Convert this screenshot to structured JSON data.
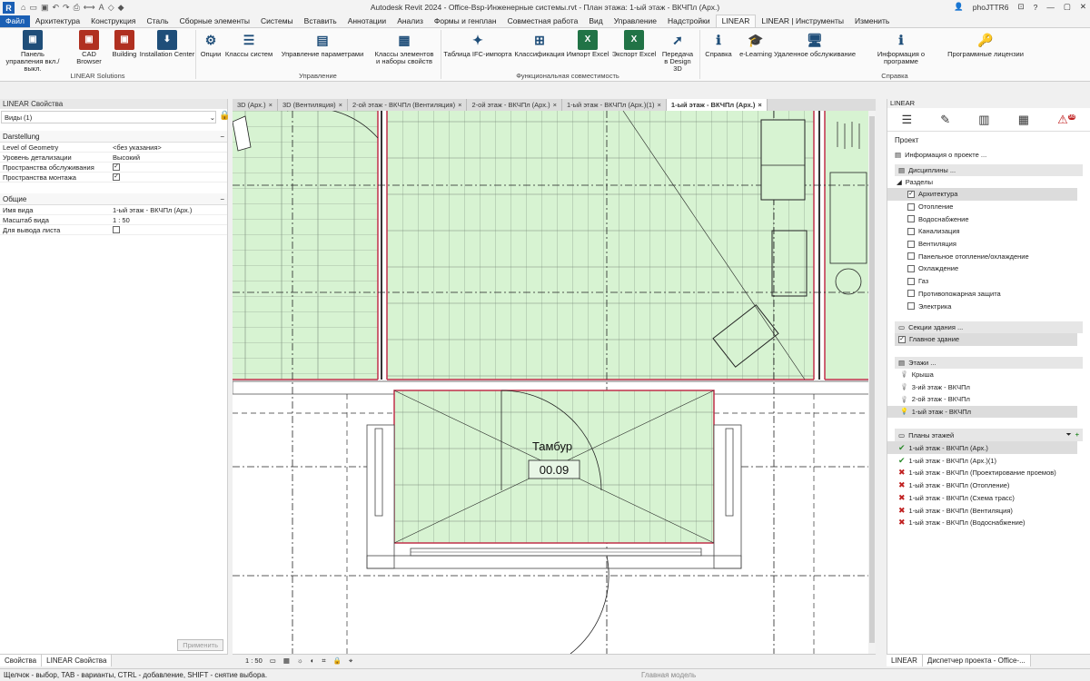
{
  "app": {
    "title": "Autodesk Revit 2024 - Office-Bsp-Инженерные системы.rvt - План этажа: 1-ый этаж - ВКЧПл (Арх.)",
    "user": "phoJTTR6"
  },
  "menu": [
    "Файл",
    "Архитектура",
    "Конструкция",
    "Сталь",
    "Сборные элементы",
    "Системы",
    "Вставить",
    "Аннотации",
    "Анализ",
    "Формы и генплан",
    "Совместная работа",
    "Вид",
    "Управление",
    "Надстройки",
    "LINEAR",
    "LINEAR | Инструменты",
    "Изменить"
  ],
  "ribbon": {
    "buttons": [
      {
        "label": "Панель управления вкл./выкл.",
        "color": "#1f4e79"
      },
      {
        "label": "CAD Browser",
        "color": "#b03020"
      },
      {
        "label": "Building",
        "color": "#b03020"
      },
      {
        "label": "Installation Center",
        "color": "#1f4e79"
      },
      {
        "label": "Опции"
      },
      {
        "label": "Классы систем"
      },
      {
        "label": "Управление параметрами"
      },
      {
        "label": "Классы элементов и наборы свойств"
      },
      {
        "label": "Таблица IFC-импорта"
      },
      {
        "label": "Классификация"
      },
      {
        "label": "Импорт Excel",
        "color": "#217346"
      },
      {
        "label": "Экспорт Excel",
        "color": "#217346"
      },
      {
        "label": "Передача в Design 3D"
      },
      {
        "label": "Справка"
      },
      {
        "label": "e-Learning"
      },
      {
        "label": "Удаленное обслуживание"
      },
      {
        "label": "Информация о программе"
      },
      {
        "label": "Программные лицензии"
      }
    ],
    "groups": [
      "LINEAR Solutions",
      "Управление",
      "Функциональная совместимость",
      "Справка"
    ]
  },
  "props": {
    "title": "LINEAR Свойства",
    "type": "Виды (1)",
    "darstellung": "Darstellung",
    "rows1": [
      {
        "k": "Level of Geometry",
        "v": "<без указания>"
      },
      {
        "k": "Уровень детализации",
        "v": "Высокий"
      },
      {
        "k": "Пространства обслуживания",
        "v": "✓"
      },
      {
        "k": "Пространства монтажа",
        "v": "✓"
      }
    ],
    "general": "Общие",
    "rows2": [
      {
        "k": "Имя вида",
        "v": "1-ый этаж - ВКЧПл (Арх.)"
      },
      {
        "k": "Масштаб вида",
        "v": "1 : 50"
      },
      {
        "k": "Для вывода листа",
        "v": ""
      }
    ],
    "apply": "Применить",
    "tabs": [
      "Свойства",
      "LINEAR Свойства"
    ]
  },
  "viewtabs": [
    "3D (Арх.)",
    "3D (Вентиляция)",
    "2-ой этаж - ВКЧПл (Вентиляция)",
    "2-ой этаж - ВКЧПл (Арх.)",
    "1-ый этаж - ВКЧПл (Арх.)(1)",
    "1-ый этаж - ВКЧПл (Арх.)"
  ],
  "room": {
    "name": "Тамбур",
    "number": "00.09"
  },
  "viewctrl": {
    "scale": "1 : 50"
  },
  "linear": {
    "title": "LINEAR",
    "project": "Проект",
    "info": "Информация о проекте ...",
    "disciplines": "Дисциплины ...",
    "sections": "Разделы",
    "items": [
      {
        "label": "Архитектура",
        "checked": true
      },
      {
        "label": "Отопление",
        "checked": false
      },
      {
        "label": "Водоснабжение",
        "checked": false
      },
      {
        "label": "Канализация",
        "checked": false
      },
      {
        "label": "Вентиляция",
        "checked": false
      },
      {
        "label": "Панельное отопление/охлаждение",
        "checked": false
      },
      {
        "label": "Охлаждение",
        "checked": false
      },
      {
        "label": "Газ",
        "checked": false
      },
      {
        "label": "Противопожарная защита",
        "checked": false
      },
      {
        "label": "Электрика",
        "checked": false
      }
    ],
    "sections_bldg": "Секции здания ...",
    "main_bldg": "Главное здание",
    "levels_head": "Этажи ...",
    "levels": [
      "Крыша",
      "3-ий этаж - ВКЧПл",
      "2-ой этаж - ВКЧПл",
      "1-ый этаж - ВКЧПл"
    ],
    "plans_head": "Планы этажей",
    "plans": [
      {
        "label": "1-ый этаж - ВКЧПл (Арх.)",
        "ok": true
      },
      {
        "label": "1-ый этаж - ВКЧПл (Арх.)(1)",
        "ok": true
      },
      {
        "label": "1-ый этаж - ВКЧПл (Проектирование проемов)",
        "ok": false
      },
      {
        "label": "1-ый этаж - ВКЧПл (Отопление)",
        "ok": false
      },
      {
        "label": "1-ый этаж - ВКЧПл (Схема трасс)",
        "ok": false
      },
      {
        "label": "1-ый этаж - ВКЧПл (Вентиляция)",
        "ok": false
      },
      {
        "label": "1-ый этаж - ВКЧПл (Водоснабжение)",
        "ok": false
      }
    ],
    "notif": "98",
    "tabs": [
      "LINEAR",
      "Диспетчер проекта - Office-..."
    ]
  },
  "status": {
    "text": "Щелчок - выбор, TAB - варианты, CTRL - добавление, SHIFT - снятие выбора.",
    "model": "Главная модель"
  }
}
